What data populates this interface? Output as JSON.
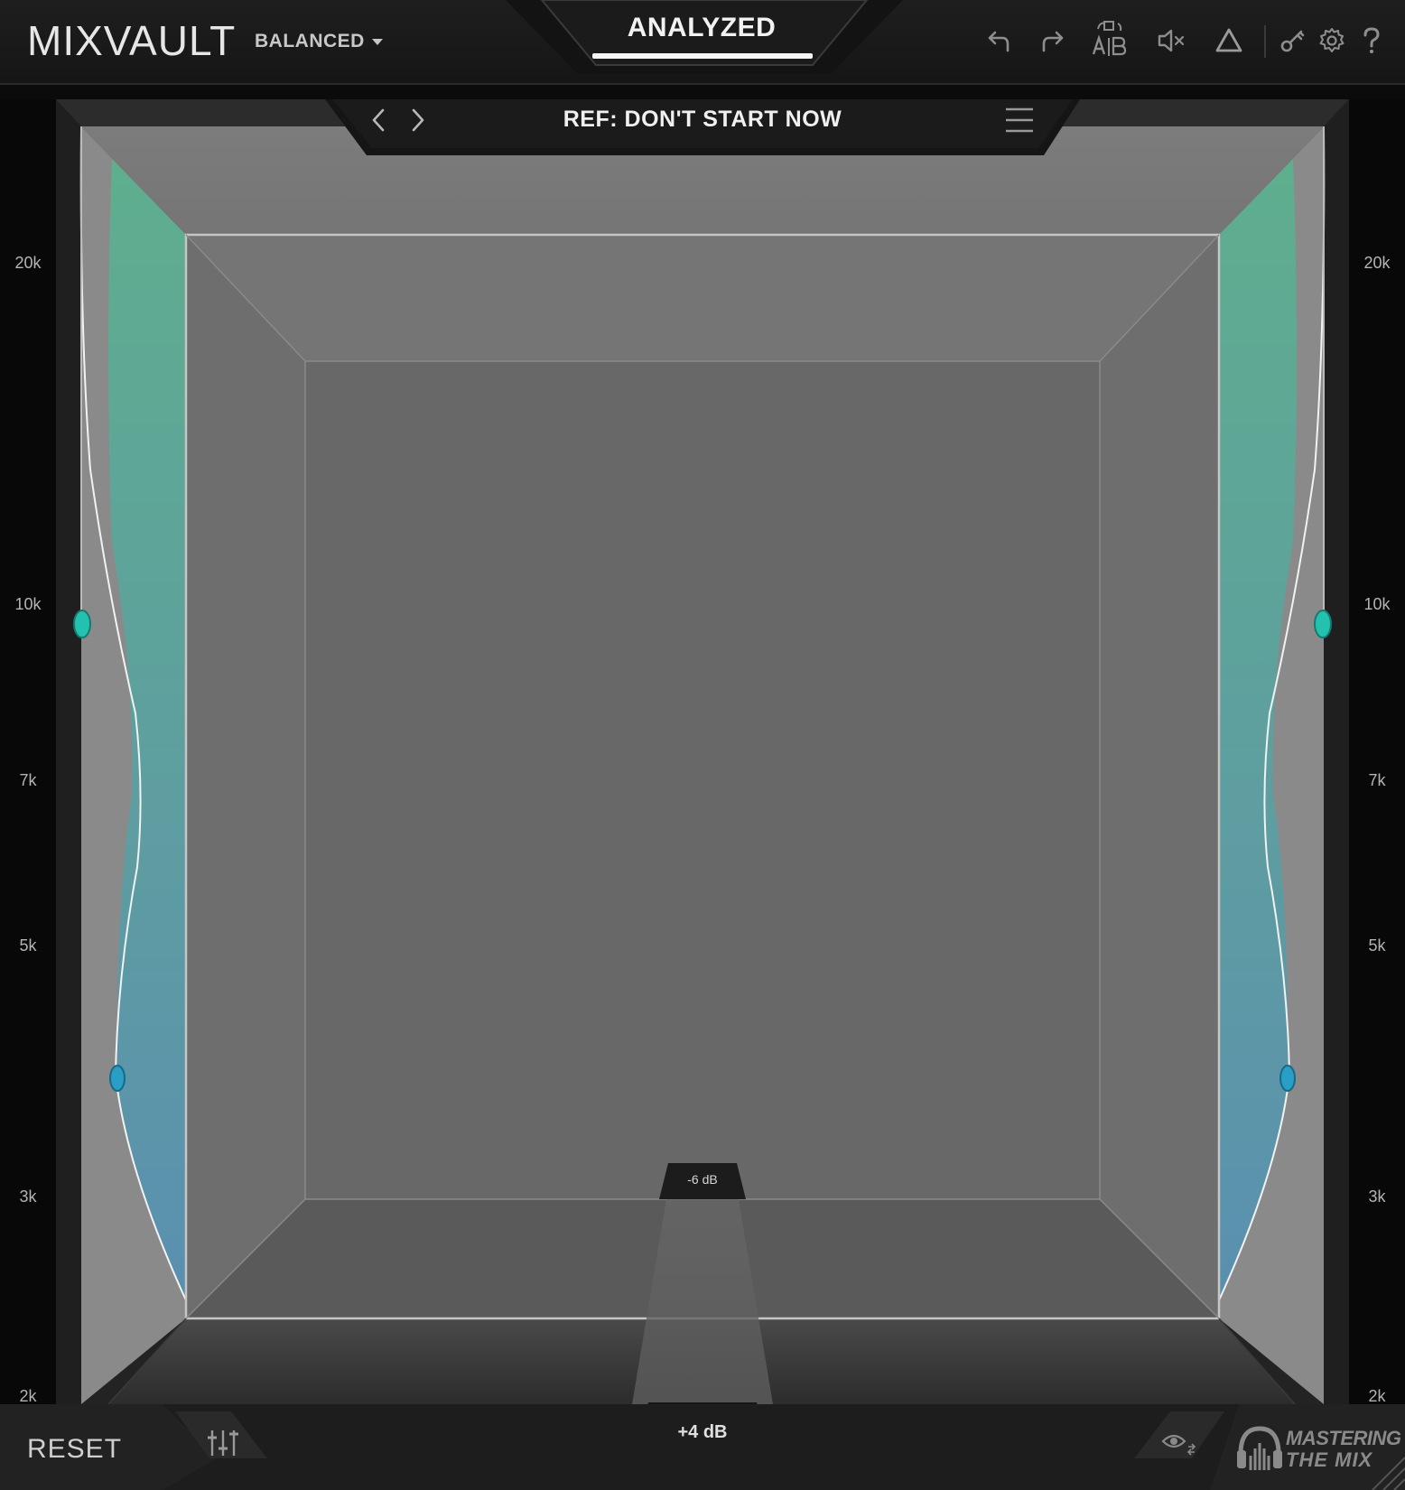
{
  "app": {
    "title": "MIXVAULT"
  },
  "header": {
    "preset": "BALANCED",
    "mode_tab": "ANALYZED",
    "icons": [
      "undo-icon",
      "redo-icon",
      "ab-compare-icon",
      "mute-icon",
      "delta-icon",
      "key-icon",
      "gear-icon",
      "help-icon"
    ]
  },
  "reference": {
    "label": "REF: DON'T START NOW"
  },
  "scale": {
    "labels": [
      "20k",
      "10k",
      "7k",
      "5k",
      "3k",
      "2k"
    ]
  },
  "meter": {
    "db_top": "-6 dB",
    "db_bottom": "+4 dB"
  },
  "footer": {
    "reset_label": "RESET",
    "brand_line1": "MASTERING",
    "brand_line2": "THE MIX"
  },
  "colors": {
    "accent_teal": "#22c1b0",
    "accent_blue": "#2a9ec6",
    "fill_top": "#5fae8e",
    "fill_bottom": "#5a8fb0",
    "bg_panel": "#7a7a7a"
  }
}
